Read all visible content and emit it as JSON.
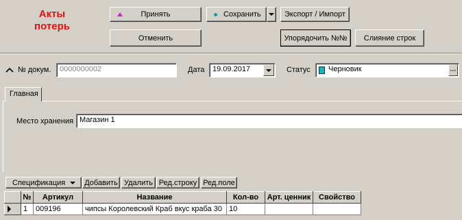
{
  "header": {
    "title_line1": "Акты",
    "title_line2": "потерь",
    "buttons": {
      "accept": "Принять",
      "save": "Сохранить",
      "export_import": "Экспорт / Импорт",
      "cancel": "Отменить",
      "reorder": "Упорядочить №№",
      "merge_rows": "Слияние строк"
    },
    "accent_colors": {
      "title": "#e01010",
      "accept_icon": "#d020d0",
      "save_icon": "#10a0a0"
    }
  },
  "document": {
    "doc_no_label": "№ докум.",
    "doc_no_value": "0000000002",
    "date_label": "Дата",
    "date_value": "19.09.2017",
    "status_label": "Статус",
    "status_value": "Черновик",
    "status_icon": "document-icon",
    "status_more": "···"
  },
  "tabs": [
    {
      "label": "Главная",
      "active": true
    }
  ],
  "main": {
    "storage_label": "Место хранения",
    "storage_value": "Магазин 1"
  },
  "spec_toolbar": {
    "spec_dropdown": "Спецификация",
    "add": "Добавить",
    "delete": "Удалить",
    "edit_row": "Ред.строку",
    "edit_field": "Ред.поле"
  },
  "table": {
    "columns": [
      "№",
      "Артикул",
      "Название",
      "Кол-во",
      "Арт. ценник",
      "Свойство"
    ],
    "rows": [
      {
        "no": "1",
        "article": "009196",
        "name": "чипсы Королевский Краб вкус краба 30",
        "qty": "10",
        "price_tag_article": "",
        "property": ""
      }
    ]
  }
}
